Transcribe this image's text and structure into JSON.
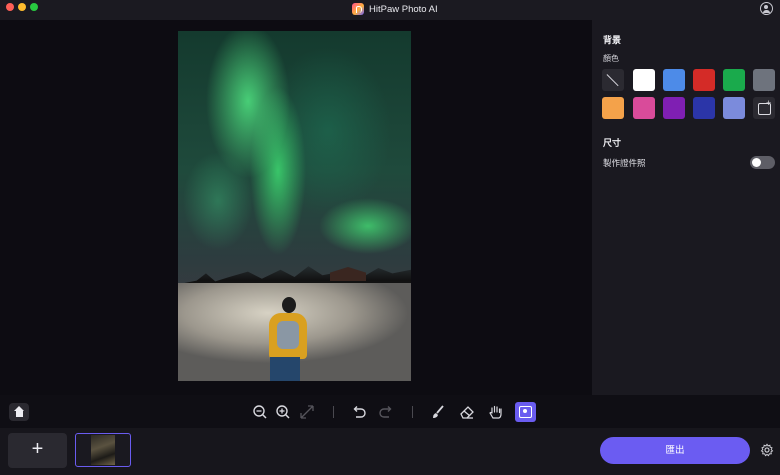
{
  "window": {
    "title": "HitPaw Photo AI"
  },
  "panel": {
    "background_title": "背景",
    "color_label": "顏色",
    "swatches": [
      {
        "name": "none",
        "color": "none"
      },
      {
        "name": "white",
        "color": "#ffffff"
      },
      {
        "name": "blue",
        "color": "#4d8be8"
      },
      {
        "name": "red",
        "color": "#d42b27"
      },
      {
        "name": "green",
        "color": "#1aaa4c"
      },
      {
        "name": "gray",
        "color": "#6e737d"
      },
      {
        "name": "orange",
        "color": "#f4a24a"
      },
      {
        "name": "pink",
        "color": "#d94b9a"
      },
      {
        "name": "purple",
        "color": "#7f1fb3"
      },
      {
        "name": "navy",
        "color": "#2b35a8"
      },
      {
        "name": "lavender",
        "color": "#7b8bdc"
      },
      {
        "name": "custom-image",
        "color": "none"
      }
    ],
    "size_title": "尺寸",
    "id_photo_label": "製作證件照",
    "id_photo_enabled": false
  },
  "toolbar": {
    "icons": [
      "home-icon",
      "zoom-out-icon",
      "zoom-in-icon",
      "fit-icon",
      "undo-icon",
      "redo-icon",
      "brush-icon",
      "eraser-icon",
      "hand-icon",
      "portrait-select-icon"
    ]
  },
  "bottombar": {
    "add_label": "+",
    "export_label": "匯出"
  },
  "colors": {
    "accent": "#6b5cf2"
  }
}
